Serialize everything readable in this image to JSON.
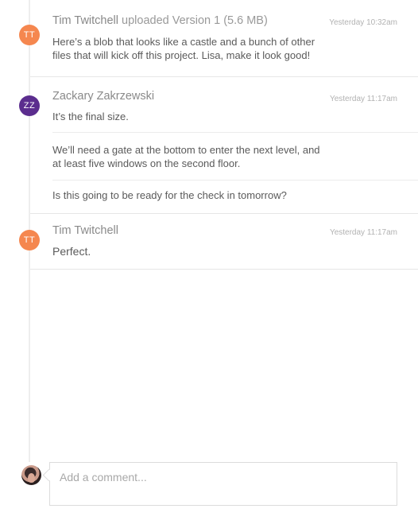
{
  "activity": [
    {
      "avatar_initials": "TT",
      "author": "Tim Twitchell",
      "action": "uploaded Version 1 (5.6 MB)",
      "timestamp": "Yesterday 10:32am",
      "lines": [
        "Here’s a blob that looks like a castle and a bunch of other",
        "files that will kick off this project. Lisa, make it look good!"
      ]
    },
    {
      "avatar_initials": "ZZ",
      "author": "Zackary Zakrzewski",
      "timestamp": "Yesterday 11:17am",
      "messages": [
        [
          "It’s the final size."
        ],
        [
          "We’ll need a gate at the bottom to enter the next level, and",
          "at least five windows on the second floor."
        ],
        [
          "Is this going to be ready for the check in tomorrow?"
        ]
      ]
    },
    {
      "avatar_initials": "TT",
      "author": "Tim Twitchell",
      "timestamp": "Yesterday 11:17am",
      "messages": [
        [
          "Perfect."
        ]
      ]
    }
  ],
  "composer": {
    "placeholder": "Add a comment..."
  },
  "colors": {
    "tt_avatar": "#f5874f",
    "zz_avatar": "#5b2d8e"
  }
}
